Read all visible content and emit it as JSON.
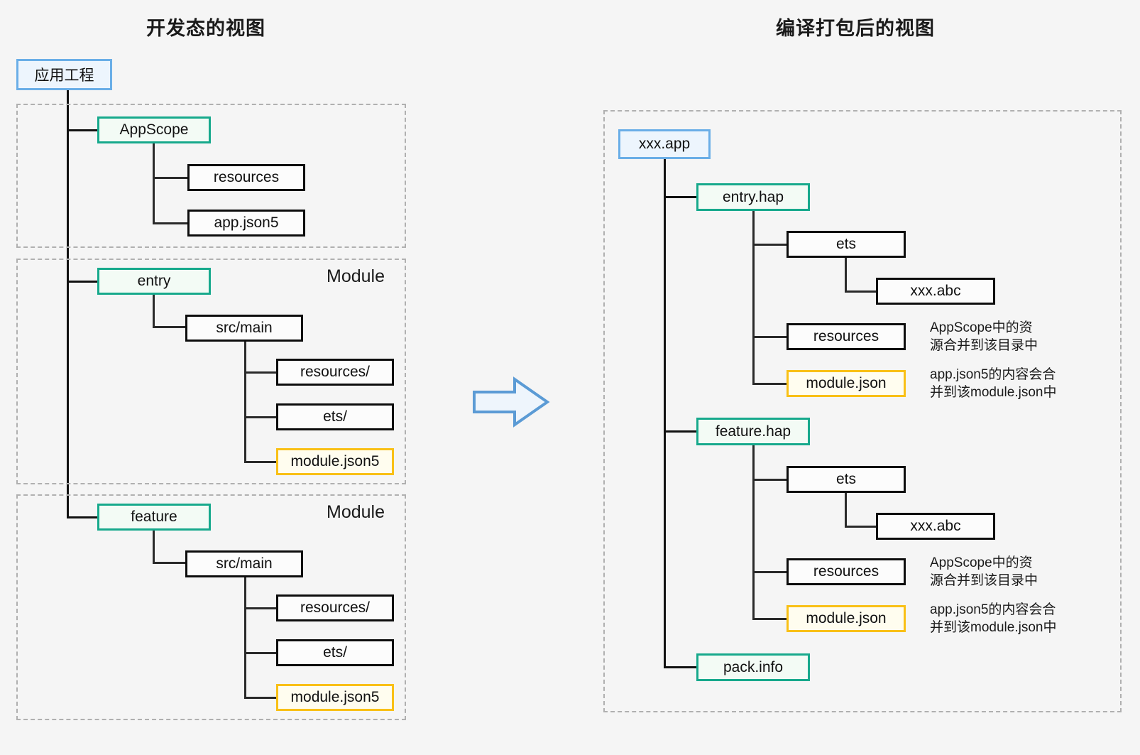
{
  "panels": {
    "left": {
      "title": "开发态的视图",
      "root": {
        "label": "应用工程",
        "style": "blue"
      },
      "groups": [
        {
          "label": ""
        },
        {
          "label": "Module"
        },
        {
          "label": "Module"
        }
      ],
      "nodes": {
        "appscope": "AppScope",
        "appscope_resources": "resources",
        "appscope_appjson5": "app.json5",
        "entry": "entry",
        "entry_srcmain": "src/main",
        "entry_resources": "resources/",
        "entry_ets": "ets/",
        "entry_modulejson5": "module.json5",
        "feature": "feature",
        "feature_srcmain": "src/main",
        "feature_resources": "resources/",
        "feature_ets": "ets/",
        "feature_modulejson5": "module.json5"
      }
    },
    "right": {
      "title": "编译打包后的视图",
      "root": {
        "label": "xxx.app",
        "style": "blue"
      },
      "nodes": {
        "entry_hap": "entry.hap",
        "entry_ets": "ets",
        "entry_xxxabc": "xxx.abc",
        "entry_resources": "resources",
        "entry_modulejson": "module.json",
        "feature_hap": "feature.hap",
        "feature_ets": "ets",
        "feature_xxxabc": "xxx.abc",
        "feature_resources": "resources",
        "feature_modulejson": "module.json",
        "packinfo": "pack.info"
      },
      "annotations": {
        "entry_resources_note": "AppScope中的资\n源合并到该目录中",
        "entry_modulejson_note": "app.json5的内容会合\n并到该module.json中",
        "feature_resources_note": "AppScope中的资\n源合并到该目录中",
        "feature_modulejson_note": "app.json5的内容会合\n并到该module.json中"
      }
    }
  },
  "arrow": {
    "name": "right-arrow",
    "color": "#5b9bd5",
    "fill": "#eef5fc"
  },
  "colors": {
    "background": "#f5f5f5",
    "blue_border": "#6aaee7",
    "blue_fill": "#edf5fd",
    "teal_border": "#17a98c",
    "teal_fill": "#f3fbf5",
    "amber_border": "#f9c016",
    "amber_fill": "#fffdef",
    "node_border": "#0d0d0d",
    "dashed_border": "#b0b0b0",
    "text": "#111111"
  }
}
